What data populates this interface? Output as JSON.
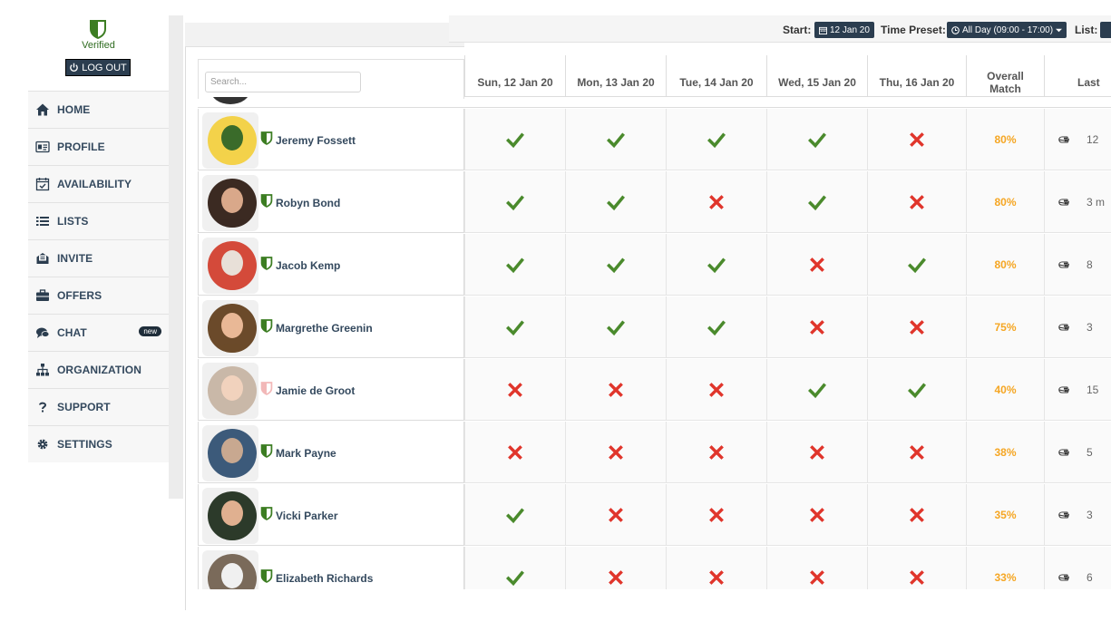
{
  "brand": {
    "status": "Verified",
    "logout_label": "LOG OUT"
  },
  "nav": [
    {
      "key": "home",
      "label": "HOME",
      "icon": "home-icon"
    },
    {
      "key": "profile",
      "label": "PROFILE",
      "icon": "id-card-icon"
    },
    {
      "key": "availability",
      "label": "AVAILABILITY",
      "icon": "calendar-check-icon"
    },
    {
      "key": "lists",
      "label": "LISTS",
      "icon": "list-icon"
    },
    {
      "key": "invite",
      "label": "INVITE",
      "icon": "envelope-open-icon"
    },
    {
      "key": "offers",
      "label": "OFFERS",
      "icon": "briefcase-icon"
    },
    {
      "key": "chat",
      "label": "CHAT",
      "icon": "comments-icon",
      "badge": "new"
    },
    {
      "key": "organization",
      "label": "ORGANIZATION",
      "icon": "sitemap-icon"
    },
    {
      "key": "support",
      "label": "SUPPORT",
      "icon": "question-icon"
    },
    {
      "key": "settings",
      "label": "SETTINGS",
      "icon": "gear-icon"
    }
  ],
  "toolbar": {
    "start_label": "Start:",
    "start_value": "12 Jan 20",
    "preset_label": "Time Preset:",
    "preset_value": "All Day (09:00 - 17:00)",
    "list_label": "List:"
  },
  "search": {
    "placeholder": "Search..."
  },
  "columns": [
    "Sun, 12 Jan 20",
    "Mon, 13 Jan 20",
    "Tue, 14 Jan 20",
    "Wed, 15 Jan 20",
    "Thu, 16 Jan 20",
    "Overall\nMatch",
    "Last"
  ],
  "people": [
    {
      "name": "Jeremy Fossett",
      "verified": true,
      "days": [
        true,
        true,
        true,
        true,
        false
      ],
      "match": "80%",
      "last": "12"
    },
    {
      "name": "Robyn Bond",
      "verified": true,
      "days": [
        true,
        true,
        false,
        true,
        false
      ],
      "match": "80%",
      "last": "3 m"
    },
    {
      "name": "Jacob Kemp",
      "verified": true,
      "days": [
        true,
        true,
        true,
        false,
        true
      ],
      "match": "80%",
      "last": "8"
    },
    {
      "name": "Margrethe Greenin",
      "verified": true,
      "days": [
        true,
        true,
        true,
        false,
        false
      ],
      "match": "75%",
      "last": "3"
    },
    {
      "name": "Jamie de Groot",
      "verified": false,
      "days": [
        false,
        false,
        false,
        true,
        true
      ],
      "match": "40%",
      "last": "15"
    },
    {
      "name": "Mark Payne",
      "verified": true,
      "days": [
        false,
        false,
        false,
        false,
        false
      ],
      "match": "38%",
      "last": "5"
    },
    {
      "name": "Vicki Parker",
      "verified": true,
      "days": [
        true,
        false,
        false,
        false,
        false
      ],
      "match": "35%",
      "last": "3"
    },
    {
      "name": "Elizabeth Richards",
      "verified": true,
      "days": [
        true,
        false,
        false,
        false,
        false
      ],
      "match": "33%",
      "last": "6"
    }
  ],
  "colors": {
    "accent_dark": "#2b3d4f",
    "check_green": "#4a8a2c",
    "cross_red": "#e0352b",
    "match_orange": "#f5a623",
    "shield_green": "#3c7d22",
    "shield_unverified": "#f2b8b8"
  }
}
